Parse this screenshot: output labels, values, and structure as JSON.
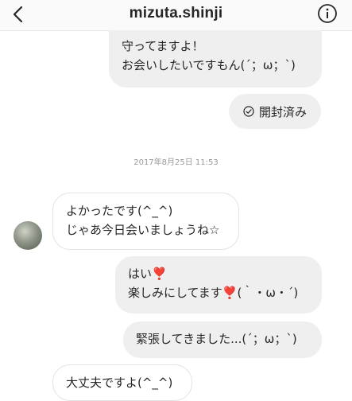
{
  "header": {
    "username": "mizuta.shinji"
  },
  "messages": {
    "m1_line1": "守ってますよ！",
    "m1_line2": "お会いしたいですもん(´；ω；`)",
    "read_status": "開封済み",
    "timestamp": "2017年8月25日 11:53",
    "m2_line1": "よかったです(^_^)",
    "m2_line2": "じゃあ今日会いましょうね☆",
    "m3_line1_text": "はい",
    "m3_line2_text": "楽しみにしてます",
    "m3_line2_suffix": "(｀・ω・´)",
    "heart": "❣️",
    "m4": "緊張してきました...(´；ω；`)",
    "m5": "大丈夫ですよ(^_^)"
  },
  "colors": {
    "header_bg": "#fafafa",
    "bubble_outgoing": "#efefef",
    "bubble_incoming": "#ffffff",
    "heart": "#d8202a"
  }
}
